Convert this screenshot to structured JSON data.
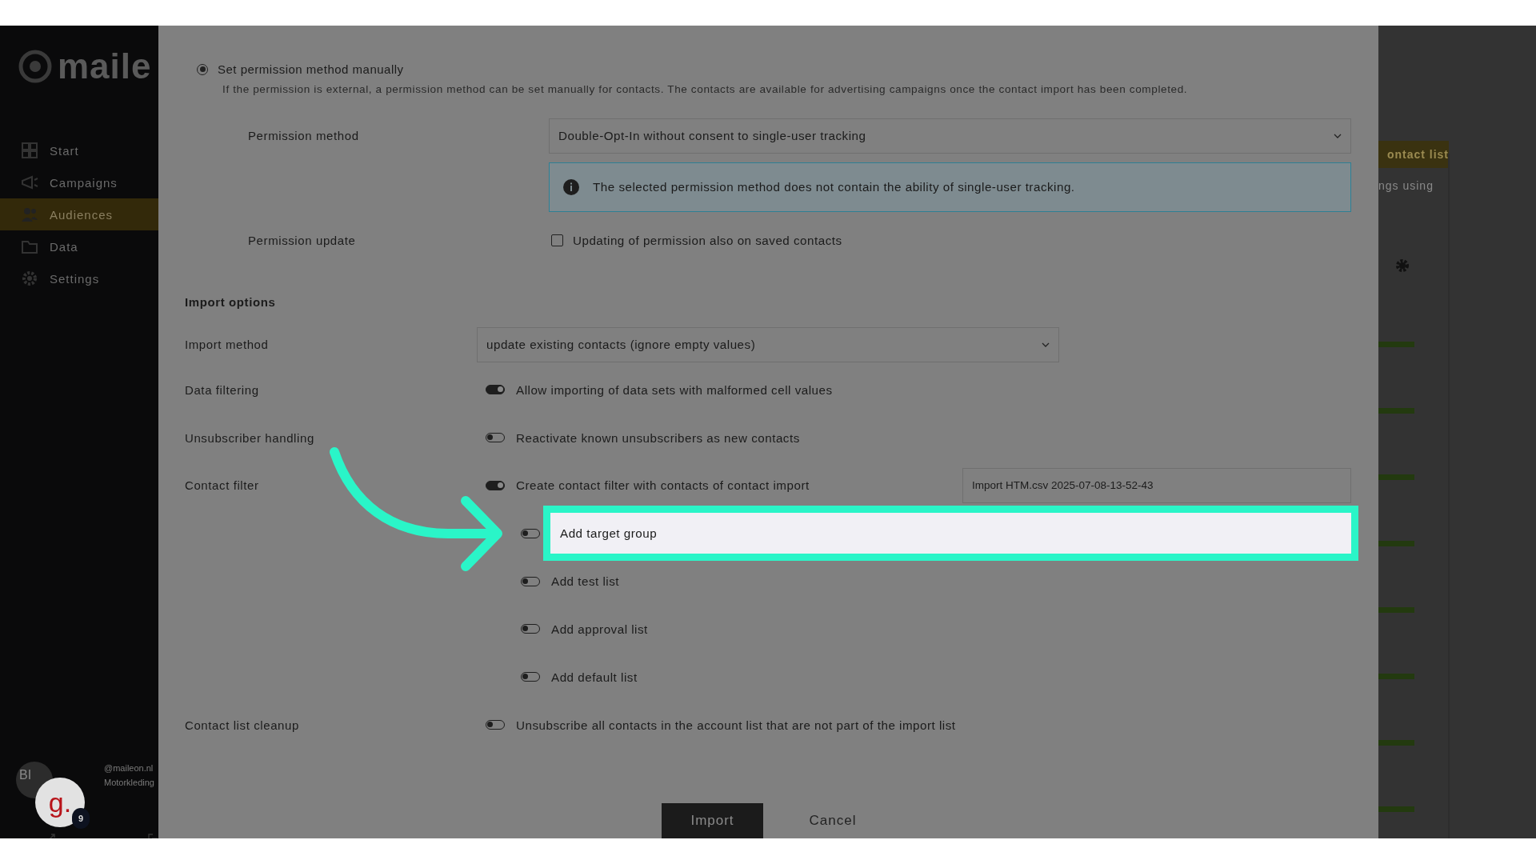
{
  "sidebar": {
    "logo": "maile",
    "items": [
      {
        "label": "Start",
        "selected": false
      },
      {
        "label": "Campaigns",
        "selected": false
      },
      {
        "label": "Audiences",
        "selected": true
      },
      {
        "label": "Data",
        "selected": false
      },
      {
        "label": "Settings",
        "selected": false
      }
    ],
    "account": {
      "initials": "BI",
      "email": "@maileon.nl",
      "company": "Motorkleding"
    },
    "guide_badge": {
      "text": "g.",
      "count": "9"
    }
  },
  "form": {
    "permission_option": {
      "label": "Set permission method manually",
      "selected": true,
      "description": "If the permission is external, a permission method can be set manually for contacts. The contacts are available for advertising campaigns once the contact import has been completed."
    },
    "permission_method": {
      "label": "Permission method",
      "value": "Double-Opt-In without consent to single-user tracking",
      "info": "The selected permission method does not contain the ability of single-user tracking."
    },
    "permission_update": {
      "label": "Permission update",
      "option": "Updating of permission also on saved contacts",
      "checked": false
    },
    "import_options_heading": "Import options",
    "import_method": {
      "label": "Import method",
      "value": "update existing contacts (ignore empty values)"
    },
    "toggle_rows": [
      {
        "label": "Data filtering",
        "text": "Allow importing of data sets with malformed cell values",
        "on": true
      },
      {
        "label": "Unsubscriber handling",
        "text": "Reactivate known unsubscribers as new contacts",
        "on": false
      },
      {
        "label": "Contact filter",
        "text": "Create contact filter with contacts of contact import",
        "on": true,
        "field_value": "Import HTM.csv 2025-07-08-13-52-43",
        "children": [
          {
            "text": "Add target group",
            "on": false,
            "highlighted": true
          },
          {
            "text": "Add test list",
            "on": false,
            "highlighted": false
          },
          {
            "text": "Add approval list",
            "on": false,
            "highlighted": false
          },
          {
            "text": "Add default list",
            "on": false,
            "highlighted": false
          }
        ]
      },
      {
        "label": "Contact list cleanup",
        "text": "Unsubscribe all contacts in the account list that are not part of the import list",
        "on": false
      }
    ],
    "buttons": [
      {
        "label": "Import",
        "kind": "primary"
      },
      {
        "label": "Cancel",
        "kind": "secondary"
      }
    ]
  },
  "background_panel": {
    "button": "ontact list",
    "text": "ngs using"
  }
}
